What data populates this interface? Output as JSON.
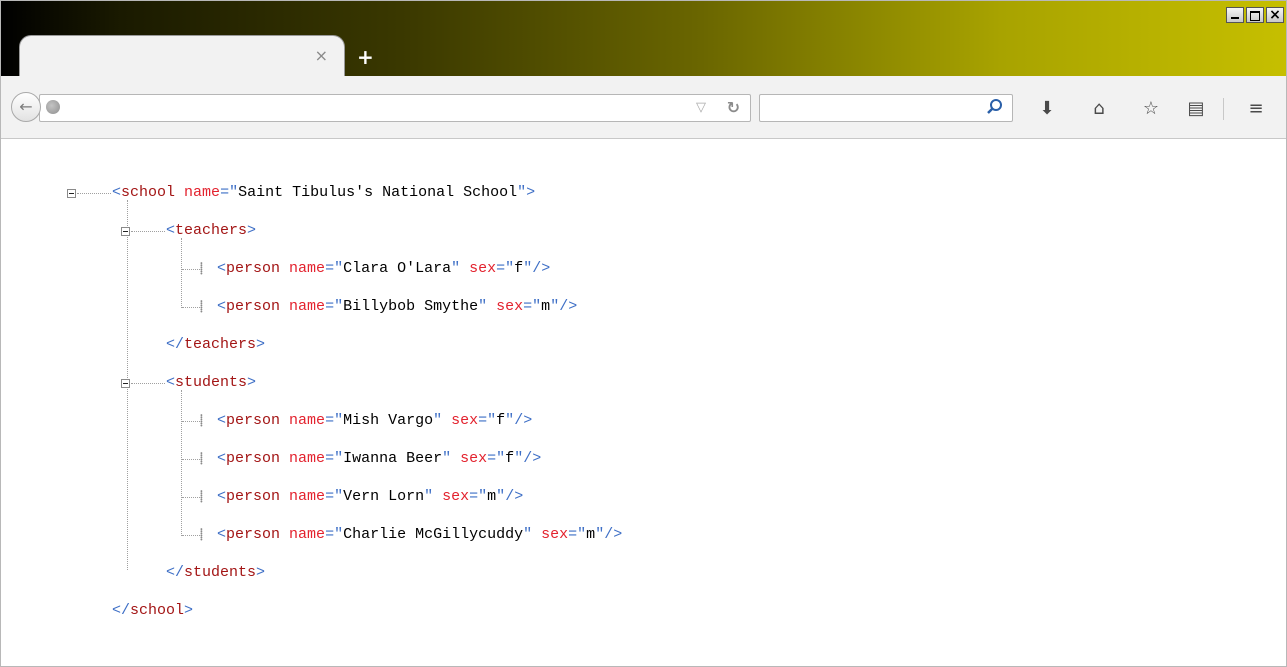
{
  "browser": {
    "tab_close_glyph": "×",
    "new_tab_glyph": "+",
    "window_close_glyph": "×",
    "url": "",
    "search_placeholder": "",
    "icons": [
      "back-icon",
      "globe-icon",
      "dropmarker-icon",
      "reload-icon",
      "search-icon",
      "download-icon",
      "home-icon",
      "bookmark-star-icon",
      "reading-list-icon",
      "menu-icon"
    ]
  },
  "xml": {
    "root_open": {
      "tag": "school",
      "attrs": [
        {
          "name": "name",
          "value": "Saint Tibulus's National School"
        }
      ]
    },
    "teachers_open": {
      "tag": "teachers"
    },
    "teachers": [
      {
        "tag": "person",
        "attrs": [
          {
            "name": "name",
            "value": "Clara O'Lara"
          },
          {
            "name": "sex",
            "value": "f"
          }
        ]
      },
      {
        "tag": "person",
        "attrs": [
          {
            "name": "name",
            "value": "Billybob Smythe"
          },
          {
            "name": "sex",
            "value": "m"
          }
        ]
      }
    ],
    "teachers_close": {
      "tag": "teachers"
    },
    "students_open": {
      "tag": "students"
    },
    "students": [
      {
        "tag": "person",
        "attrs": [
          {
            "name": "name",
            "value": "Mish Vargo"
          },
          {
            "name": "sex",
            "value": "f"
          }
        ]
      },
      {
        "tag": "person",
        "attrs": [
          {
            "name": "name",
            "value": "Iwanna Beer"
          },
          {
            "name": "sex",
            "value": "f"
          }
        ]
      },
      {
        "tag": "person",
        "attrs": [
          {
            "name": "name",
            "value": "Vern Lorn"
          },
          {
            "name": "sex",
            "value": "m"
          }
        ]
      },
      {
        "tag": "person",
        "attrs": [
          {
            "name": "name",
            "value": "Charlie McGillycuddy"
          },
          {
            "name": "sex",
            "value": "m"
          }
        ]
      }
    ],
    "students_close": {
      "tag": "students"
    },
    "root_close": {
      "tag": "school"
    }
  },
  "colors": {
    "tag": "#a31515",
    "bracket": "#3e6fc6",
    "attribute": "#e3222e",
    "value": "#000000"
  }
}
